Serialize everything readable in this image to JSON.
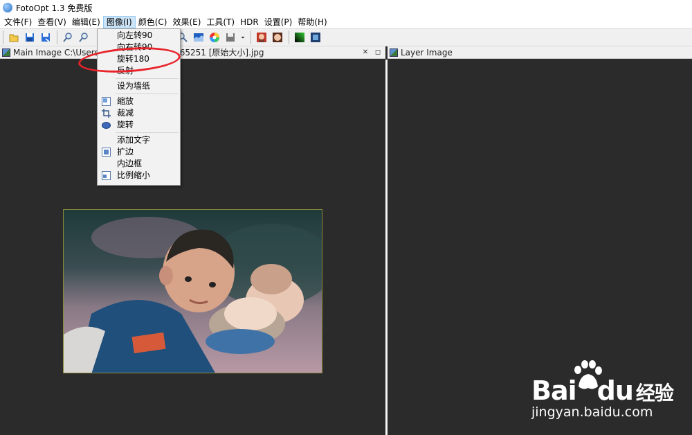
{
  "app": {
    "title": "FotoOpt 1.3 免费版"
  },
  "menubar": {
    "items": [
      "文件(F)",
      "查看(V)",
      "编辑(E)",
      "图像(I)",
      "颜色(C)",
      "效果(E)",
      "工具(T)",
      "HDR",
      "设置(P)",
      "帮助(H)"
    ]
  },
  "image_menu": {
    "items": [
      {
        "label": "向左转90",
        "icon": ""
      },
      {
        "label": "向右转90",
        "icon": ""
      },
      {
        "label": "旋转180",
        "icon": ""
      },
      {
        "label": "反射",
        "icon": ""
      },
      {
        "label": "设为墙纸",
        "icon": ""
      },
      {
        "label": "缩放",
        "icon": "resize-icon"
      },
      {
        "label": "裁减",
        "icon": "crop-icon"
      },
      {
        "label": "旋转",
        "icon": "rotate-icon"
      },
      {
        "label": "添加文字",
        "icon": ""
      },
      {
        "label": "扩边",
        "icon": "expand-border-icon"
      },
      {
        "label": "内边框",
        "icon": ""
      },
      {
        "label": "比例缩小",
        "icon": "scale-down-icon"
      }
    ]
  },
  "panes": {
    "main_title": "Main Image C:\\Users\\0                          2\\pexels-photo-765251 [原始大小].jpg",
    "main_close": "✕",
    "main_restore": "◻",
    "layer_title": "Layer Image"
  },
  "watermark": {
    "logo": "Bai du 经验",
    "logo_b": "Bai",
    "logo_du": "du",
    "logo_cn": "经验",
    "url": "jingyan.baidu.com"
  },
  "colors": {
    "canvas": "#2b2b2b",
    "highlight_ring": "#e8232a",
    "menu_active": "#cce4f7"
  }
}
